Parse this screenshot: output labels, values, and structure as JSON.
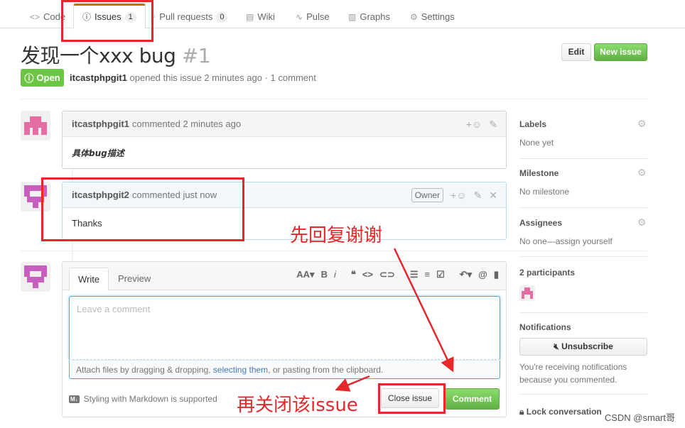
{
  "tabs": [
    {
      "label": "Code",
      "icon": "code-icon"
    },
    {
      "label": "Issues",
      "icon": "issue-opened-icon",
      "count": "1"
    },
    {
      "label": "Pull requests",
      "icon": "pull-request-icon",
      "count": "0"
    },
    {
      "label": "Wiki",
      "icon": "book-icon"
    },
    {
      "label": "Pulse",
      "icon": "pulse-icon"
    },
    {
      "label": "Graphs",
      "icon": "graph-icon"
    },
    {
      "label": "Settings",
      "icon": "gear-icon"
    }
  ],
  "issue": {
    "title": "发现一个xxx bug",
    "number": "#1",
    "state": "Open",
    "author": "itcastphpgit1",
    "meta_text": "opened this issue 2 minutes ago · 1 comment",
    "edit_label": "Edit",
    "new_issue_label": "New issue"
  },
  "comments": [
    {
      "author": "itcastphpgit1",
      "time": "commented 2 minutes ago",
      "body": "具体bug描述"
    },
    {
      "author": "itcastphpgit2",
      "time": "commented just now",
      "badge": "Owner",
      "body": "Thanks"
    }
  ],
  "new_comment": {
    "write_tab": "Write",
    "preview_tab": "Preview",
    "placeholder": "Leave a comment",
    "attach_prefix": "Attach files by dragging & dropping, ",
    "attach_link": "selecting them",
    "attach_suffix": ", or pasting from the clipboard.",
    "markdown_note": "Styling with Markdown is supported",
    "close_label": "Close issue",
    "comment_label": "Comment"
  },
  "sidebar": {
    "labels_title": "Labels",
    "labels_value": "None yet",
    "milestone_title": "Milestone",
    "milestone_value": "No milestone",
    "assignees_title": "Assignees",
    "assignees_value": "No one—assign yourself",
    "participants": "2 participants",
    "notifications_title": "Notifications",
    "unsubscribe_label": "Unsubscribe",
    "notifications_reason": "You're receiving notifications because you commented.",
    "lock_label": "Lock conversation"
  },
  "annotations": {
    "reply_first": "先回复谢谢",
    "then_close": "再关闭该issue",
    "color": "#e6282b"
  },
  "watermark": "CSDN @smart哥"
}
